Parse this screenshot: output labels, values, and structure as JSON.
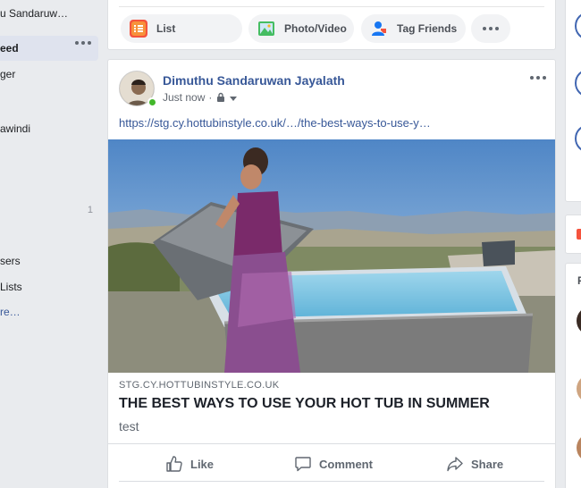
{
  "sidebar": {
    "user_name": "u Sandaruw…",
    "news_feed": "eed",
    "messenger": "ger",
    "friend": "awindi",
    "count": "1",
    "users": "sers",
    "lists": "Lists",
    "see_more": "re…"
  },
  "composer": {
    "list_label": "List",
    "photo_label": "Photo/Video",
    "tag_label": "Tag Friends"
  },
  "post": {
    "author": "Dimuthu Sandaruwan Jayalath",
    "time": "Just now",
    "link_text": "https://stg.cy.hottubinstyle.co.uk/…/the-best-ways-to-use-y…",
    "preview": {
      "domain": "STG.CY.HOTTUBINSTYLE.CO.UK",
      "title": "THE BEST WAYS TO USE YOUR HOT TUB IN SUMMER",
      "description": "test"
    },
    "actions": {
      "like": "Like",
      "comment": "Comment",
      "share": "Share"
    }
  },
  "rail": {
    "letter": "P"
  },
  "colors": {
    "brand_blue": "#385898",
    "online_green": "#42b72a",
    "background": "#e9ebee"
  }
}
